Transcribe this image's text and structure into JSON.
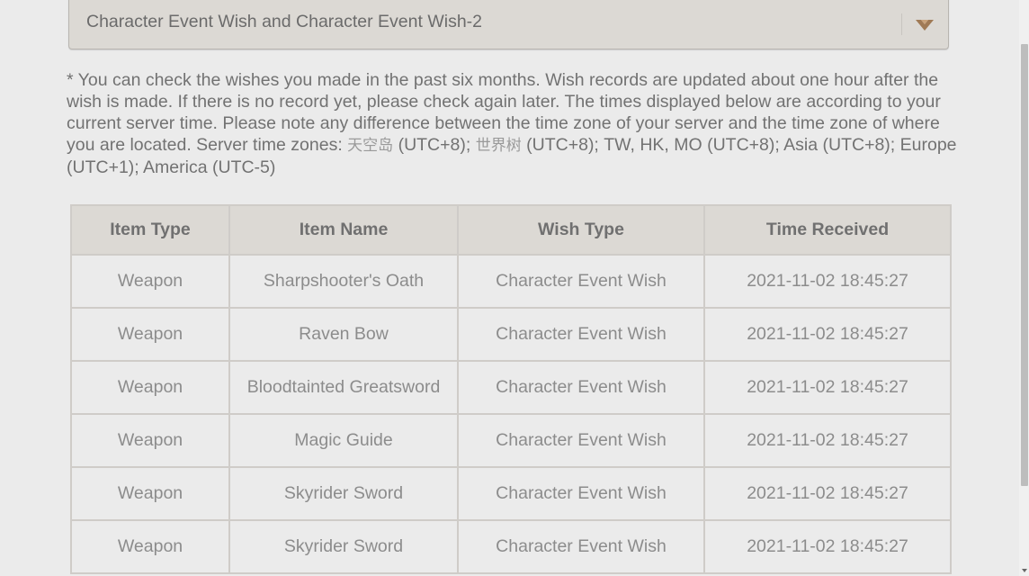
{
  "wish_selector": {
    "selected": "Character Event Wish and Character Event Wish-2",
    "icon": "chevron-down-icon",
    "accent_color": "#a07a55"
  },
  "note": {
    "text_before_cjk1": "* You can check the wishes you made in the past six months. Wish records are updated about one hour after the wish is made. If there is no record yet, please check again later. The times displayed below are according to your current server time. Please note any difference between the time zone of your server and the time zone of where you are located. Server time zones: ",
    "cjk1": "天空岛",
    "text_after_cjk1": " (UTC+8); ",
    "cjk2": "世界树",
    "text_after_cjk2": " (UTC+8); TW, HK, MO (UTC+8); Asia (UTC+8); Europe (UTC+1); America (UTC-5)"
  },
  "table": {
    "headers": [
      "Item Type",
      "Item Name",
      "Wish Type",
      "Time Received"
    ],
    "rows": [
      [
        "Weapon",
        "Sharpshooter's Oath",
        "Character Event Wish",
        "2021-11-02 18:45:27"
      ],
      [
        "Weapon",
        "Raven Bow",
        "Character Event Wish",
        "2021-11-02 18:45:27"
      ],
      [
        "Weapon",
        "Bloodtainted Greatsword",
        "Character Event Wish",
        "2021-11-02 18:45:27"
      ],
      [
        "Weapon",
        "Magic Guide",
        "Character Event Wish",
        "2021-11-02 18:45:27"
      ],
      [
        "Weapon",
        "Skyrider Sword",
        "Character Event Wish",
        "2021-11-02 18:45:27"
      ],
      [
        "Weapon",
        "Skyrider Sword",
        "Character Event Wish",
        "2021-11-02 18:45:27"
      ]
    ]
  }
}
